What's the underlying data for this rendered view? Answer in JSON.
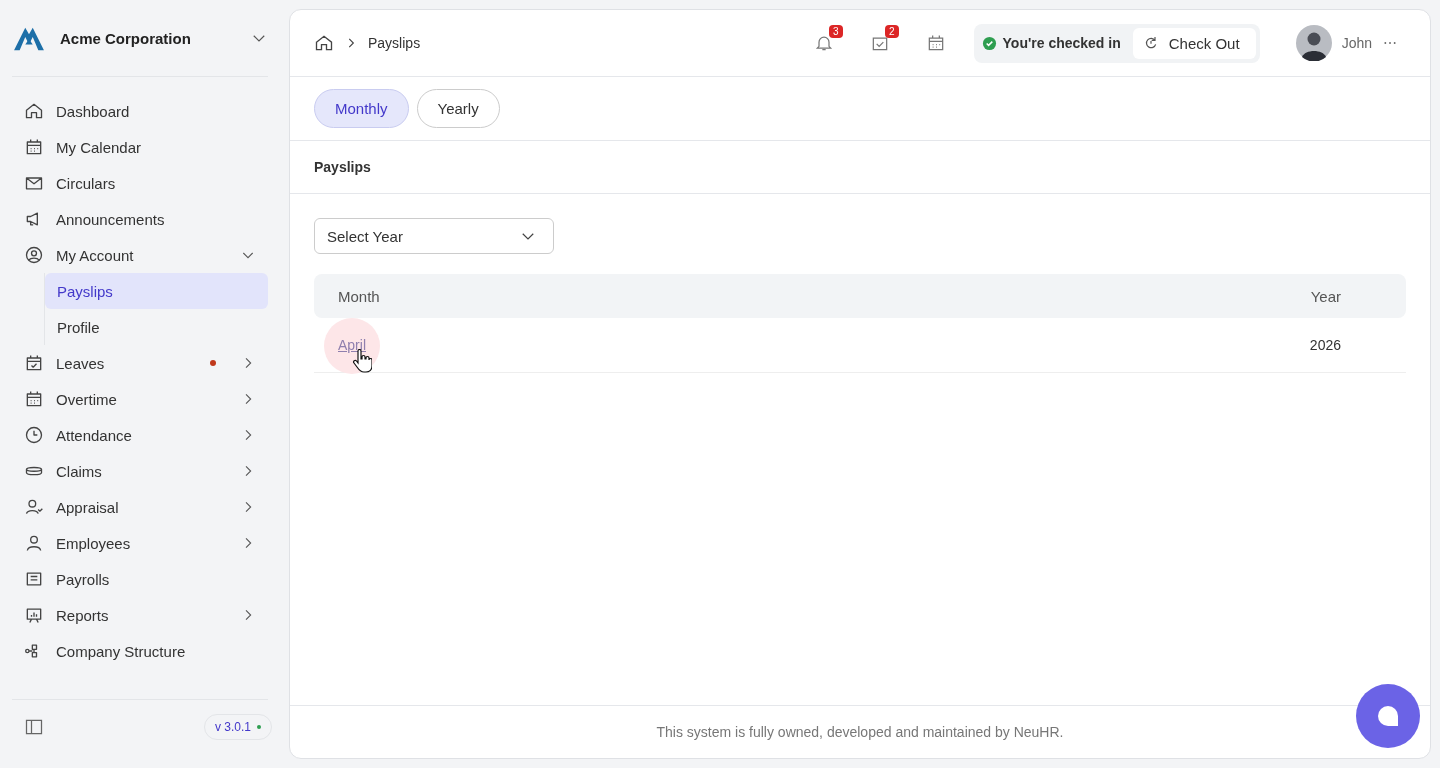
{
  "sidebar": {
    "company": "Acme Corporation",
    "items": [
      {
        "label": "Dashboard",
        "kind": "link",
        "has_submenu": false,
        "dot": false
      },
      {
        "label": "My Calendar",
        "kind": "link",
        "has_submenu": false,
        "dot": false
      },
      {
        "label": "Circulars",
        "kind": "link",
        "has_submenu": false,
        "dot": false
      },
      {
        "label": "Announcements",
        "kind": "link",
        "has_submenu": false,
        "dot": false
      },
      {
        "label": "My Account",
        "kind": "group",
        "expanded": true,
        "has_submenu": true,
        "dot": false,
        "children": [
          {
            "label": "Payslips",
            "selected": true
          },
          {
            "label": "Profile",
            "selected": false
          }
        ]
      },
      {
        "label": "Leaves",
        "kind": "link",
        "has_submenu": true,
        "dot": true
      },
      {
        "label": "Overtime",
        "kind": "link",
        "has_submenu": true,
        "dot": false
      },
      {
        "label": "Attendance",
        "kind": "link",
        "has_submenu": true,
        "dot": false
      },
      {
        "label": "Claims",
        "kind": "link",
        "has_submenu": true,
        "dot": false
      },
      {
        "label": "Appraisal",
        "kind": "link",
        "has_submenu": true,
        "dot": false
      },
      {
        "label": "Employees",
        "kind": "link",
        "has_submenu": true,
        "dot": false
      },
      {
        "label": "Payrolls",
        "kind": "link",
        "has_submenu": false,
        "dot": false
      },
      {
        "label": "Reports",
        "kind": "link",
        "has_submenu": true,
        "dot": false
      },
      {
        "label": "Company Structure",
        "kind": "link",
        "has_submenu": false,
        "dot": false
      }
    ],
    "version": "v 3.0.1"
  },
  "header": {
    "breadcrumb": [
      "Payslips"
    ],
    "notifications": "3",
    "tasks": "2",
    "status": "You're checked in",
    "check_out": "Check Out",
    "user": "John"
  },
  "tabs": [
    {
      "label": "Monthly",
      "selected": true
    },
    {
      "label": "Yearly",
      "selected": false
    }
  ],
  "section_title": "Payslips",
  "year_select": {
    "placeholder": "Select Year"
  },
  "table": {
    "columns": [
      "Month",
      "Year"
    ],
    "rows": [
      {
        "month": "April",
        "year": "2026"
      }
    ]
  },
  "footer": "This system is fully owned, developed and maintained by NeuHR."
}
